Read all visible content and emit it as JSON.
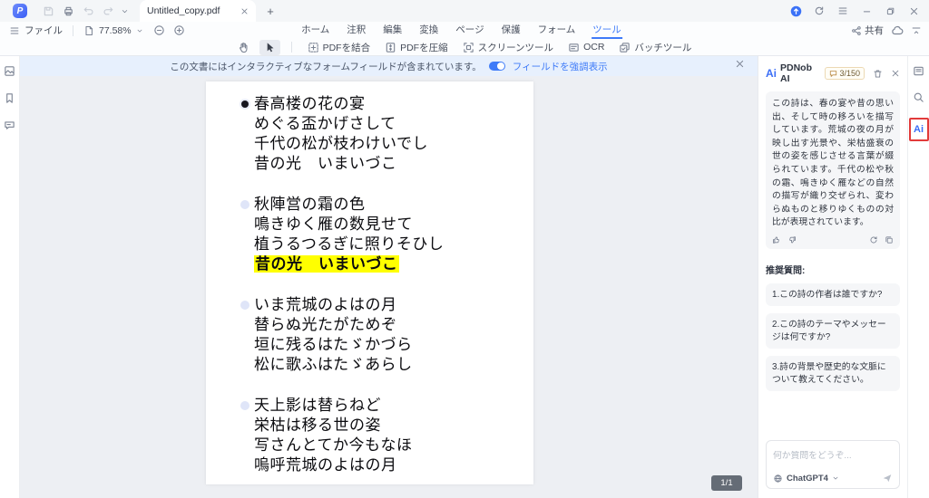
{
  "titlebar": {
    "tab_title": "Untitled_copy.pdf"
  },
  "menubar": {
    "file_label": "ファイル",
    "zoom_value": "77.58%",
    "tabs": [
      {
        "label": "ホーム"
      },
      {
        "label": "注釈"
      },
      {
        "label": "編集"
      },
      {
        "label": "変換"
      },
      {
        "label": "ページ"
      },
      {
        "label": "保護"
      },
      {
        "label": "フォーム"
      },
      {
        "label": "ツール"
      }
    ],
    "share_label": "共有"
  },
  "toolbar": {
    "buttons": [
      {
        "label": "PDFを結合"
      },
      {
        "label": "PDFを圧縮"
      },
      {
        "label": "スクリーンツール"
      },
      {
        "label": "OCR"
      },
      {
        "label": "バッチツール"
      }
    ]
  },
  "notification": {
    "message": "この文書にはインタラクティブなフォームフィールドが含まれています。",
    "toggle_label": "フィールドを強調表示"
  },
  "document": {
    "stanzas": [
      {
        "lines": [
          "春高楼の花の宴",
          "めぐる盃かげさして",
          "千代の松が枝わけいでし",
          "昔の光　いまいづこ"
        ]
      },
      {
        "lines": [
          "秋陣営の霜の色",
          "鳴きゆく雁の数見せて",
          "植うるつるぎに照りそひし",
          "昔の光　いまいづこ"
        ]
      },
      {
        "lines": [
          "いま荒城のよはの月",
          "替らぬ光たがためぞ",
          "垣に残るはたゞかづら",
          "松に歌ふはたゞあらし"
        ]
      },
      {
        "lines": [
          "天上影は替らねど",
          "栄枯は移る世の姿",
          "写さんとてか今もなほ",
          "嗚呼荒城のよはの月"
        ]
      }
    ],
    "page_indicator": "1/1"
  },
  "ai_panel": {
    "title": "PDNob AI",
    "usage_badge": "3/150",
    "response": "この詩は、春の宴や昔の思い出、そして時の移ろいを描写しています。荒城の夜の月が映し出す光景や、栄枯盛衰の世の姿を感じさせる言葉が綴られています。千代の松や秋の霜、鳴きゆく雁などの自然の描写が織り交ぜられ、変わらぬものと移りゆくものの対比が表現されています。",
    "suggested_label": "推奨質問:",
    "questions": [
      {
        "text": "1.この詩の作者は誰ですか?"
      },
      {
        "text": "2.この詩のテーマやメッセージは何ですか?"
      },
      {
        "text": "3.詩の背景や歴史的な文脈について教えてください。"
      }
    ],
    "input_placeholder": "何か質問をどうぞ...",
    "model": "ChatGPT4"
  }
}
